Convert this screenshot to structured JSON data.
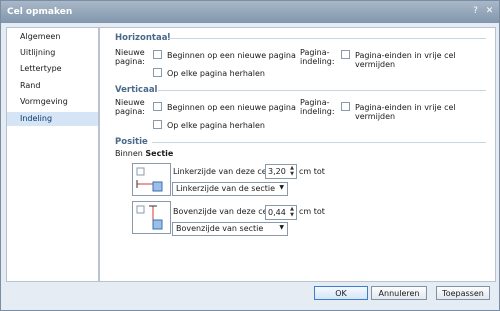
{
  "window": {
    "title": "Cel opmaken"
  },
  "sidebar": {
    "items": [
      {
        "label": "Algemeen"
      },
      {
        "label": "Uitlijning"
      },
      {
        "label": "Lettertype"
      },
      {
        "label": "Rand"
      },
      {
        "label": "Vormgeving"
      },
      {
        "label": "Indeling",
        "selected": true
      }
    ]
  },
  "horizontal": {
    "heading": "Horizontaal",
    "new_page_label": "Nieuwe pagina:",
    "opt_new_page": "Beginnen op een nieuwe pagina",
    "opt_repeat": "Op elke pagina herhalen",
    "page_layout_label": "Pagina-indeling:",
    "opt_page_breaks": "Pagina-einden in vrije cel vermijden"
  },
  "vertical": {
    "heading": "Verticaal",
    "new_page_label": "Nieuwe pagina:",
    "opt_new_page": "Beginnen op een nieuwe pagina",
    "opt_repeat": "Op elke pagina herhalen",
    "page_layout_label": "Pagina-indeling:",
    "opt_page_breaks": "Pagina-einden in vrije cel vermijden"
  },
  "position": {
    "heading": "Positie",
    "within_prefix": "Binnen",
    "within_target": "Sectie",
    "left_label": "Linkerzijde van deze cel is",
    "left_value": "3,20",
    "left_unit": "cm tot",
    "left_select": "Linkerzijde van de sectie",
    "top_label": "Bovenzijde van deze cel is",
    "top_value": "0,44",
    "top_unit": "cm tot",
    "top_select": "Bovenzijde van sectie"
  },
  "buttons": {
    "ok": "OK",
    "cancel": "Annuleren",
    "apply": "Toepassen"
  }
}
